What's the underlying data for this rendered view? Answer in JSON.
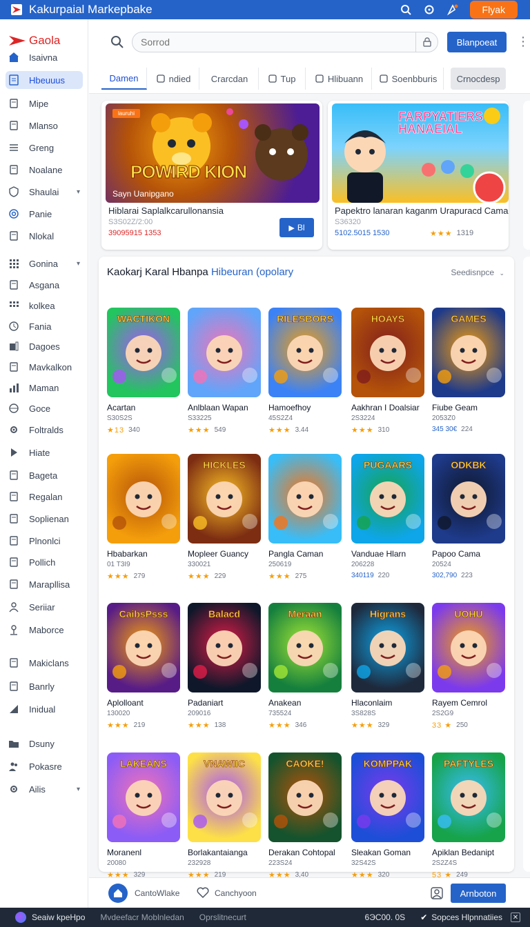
{
  "app": {
    "title": "Kakurpaial Markepbake",
    "fly_button": "Flyak",
    "brand": "Gaola",
    "colors": {
      "primary": "#2563c9",
      "brand_red": "#dc2626",
      "accent_orange": "#f97316",
      "star": "#f59e0b"
    }
  },
  "sidebar": {
    "items": [
      {
        "label": "Isaivna",
        "icon": "home-icon"
      },
      {
        "label": "Hbeuuus",
        "icon": "document-icon",
        "active": true
      },
      {
        "label": "Mipe",
        "icon": "page-icon"
      },
      {
        "label": "Mlanso",
        "icon": "edit-icon"
      },
      {
        "label": "Greng",
        "icon": "list-icon"
      },
      {
        "label": "Noalane",
        "icon": "wrench-icon"
      },
      {
        "label": "Shaulai",
        "icon": "shield-icon",
        "expandable": true
      },
      {
        "label": "Panie",
        "icon": "target-icon"
      },
      {
        "label": "Nlokal",
        "icon": "tray-icon"
      },
      {
        "label": "Gonina",
        "icon": "grid-icon",
        "expandable": true
      },
      {
        "label": "Asgana",
        "icon": "monitor-icon"
      },
      {
        "label": "kolkea",
        "icon": "apps-icon"
      },
      {
        "label": "Fania",
        "icon": "clock-icon"
      },
      {
        "label": "Dagoes",
        "icon": "chart-icon"
      },
      {
        "label": "Mavkalkon",
        "icon": "pen-icon"
      },
      {
        "label": "Maman",
        "icon": "bar-chart-icon"
      },
      {
        "label": "Goce",
        "icon": "globe-icon"
      },
      {
        "label": "Foltralds",
        "icon": "gear-icon"
      },
      {
        "label": "Hiate",
        "icon": "play-icon"
      },
      {
        "label": "Bageta",
        "icon": "note-icon"
      },
      {
        "label": "Regalan",
        "icon": "cloud-icon"
      },
      {
        "label": "Soplienan",
        "icon": "book-icon"
      },
      {
        "label": "Plnonlci",
        "icon": "compass-icon"
      },
      {
        "label": "Pollich",
        "icon": "link-icon"
      },
      {
        "label": "Marapllisa",
        "icon": "tag-icon"
      },
      {
        "label": "Seriiar",
        "icon": "user-icon"
      },
      {
        "label": "Maborce",
        "icon": "person-icon"
      },
      {
        "label": "Makiclans",
        "icon": "network-icon"
      },
      {
        "label": "Banrly",
        "icon": "clipboard-icon"
      },
      {
        "label": "Inidual",
        "icon": "signal-icon"
      },
      {
        "label": "Dsuny",
        "icon": "folder-icon"
      },
      {
        "label": "Pokasre",
        "icon": "people-icon"
      },
      {
        "label": "Ailis",
        "icon": "settings-icon",
        "expandable": true
      }
    ]
  },
  "header": {
    "search_placeholder": "Sorrod",
    "primary_button": "Blanpoeat"
  },
  "tabs": [
    {
      "label": "Damen",
      "icon": "",
      "active": true
    },
    {
      "label": "ndied",
      "icon": "search-icon"
    },
    {
      "label": "Crarcdan",
      "icon": ""
    },
    {
      "label": "Tup",
      "icon": "image-icon"
    },
    {
      "label": "Hlibuann",
      "icon": "window-icon"
    },
    {
      "label": "Soenbburis",
      "icon": "timer-icon"
    },
    {
      "label": "Crnocdesp",
      "icon": ""
    }
  ],
  "featured": [
    {
      "art_text": "POWIRD KION",
      "art_caption": "Sayn Uanipgano",
      "badge": "lauruhi",
      "title": "Hiblarai Saplalkcarullonansia",
      "sub": "S3S02Z/2:00",
      "meta": "39095915 1353",
      "button": "Bl"
    },
    {
      "art_text": "FARPYATIERS HANAEIAL",
      "title": "Papektro lanaran kaganm Urapuracd Caman",
      "sub": "S36320",
      "meta": "5102.5015 1530",
      "rating_stars": 3,
      "rating_count": "1319"
    }
  ],
  "panel": {
    "title_main": "Kaokarj Karal Hbanpa",
    "title_highlight": "Hibeuran (opolary",
    "sort_label": "Seedisnpce",
    "games": [
      {
        "art_text": "WACTIKON",
        "name": "Acartan",
        "sub": "S30S2S",
        "stars_left": "★13",
        "count": "340"
      },
      {
        "art_text": "",
        "name": "Anlblaan Wapan",
        "sub": "S33225",
        "stars_left": "★★★",
        "count": "549"
      },
      {
        "art_text": "RILESBORS",
        "name": "Hamoefhoy",
        "sub": "45S2Z4",
        "stars_left": "★★★",
        "count": "3.44"
      },
      {
        "art_text": "HOAYS",
        "name": "Aakhran I Doalsiar",
        "sub": "2S3224",
        "stars_left": "★★★",
        "count": "310"
      },
      {
        "art_text": "GAMES",
        "name": "Fiube Geam",
        "sub": "2053Z0",
        "stars_left": "345 30€",
        "count": "224",
        "blue": true
      },
      {
        "art_text": "",
        "name": "Hbabarkan",
        "sub": "01 T3I9",
        "stars_left": "★★★",
        "count": "279"
      },
      {
        "art_text": "HICKLES",
        "name": "Mopleer Guancy",
        "sub": "330021",
        "stars_left": "★★★",
        "count": "229"
      },
      {
        "art_text": "",
        "name": "Pangla Caman",
        "sub": "250619",
        "stars_left": "★★★",
        "count": "275"
      },
      {
        "art_text": "PUGAARS",
        "name": "Vanduae Hlarn",
        "sub": "206228",
        "stars_left": "340119",
        "count": "220",
        "blue": true
      },
      {
        "art_text": "ODKBK",
        "name": "Papoo Cama",
        "sub": "20524",
        "stars_left": "302,790",
        "count": "223",
        "blue": true
      },
      {
        "art_text": "CaibsPsss",
        "name": "Aplolloant",
        "sub": "130020",
        "stars_left": "★★★",
        "count": "219"
      },
      {
        "art_text": "Balacd",
        "name": "Padaniart",
        "sub": "209016",
        "stars_left": "★★★",
        "count": "138"
      },
      {
        "art_text": "Meraan",
        "name": "Anakean",
        "sub": "735524",
        "stars_left": "★★★",
        "count": "346"
      },
      {
        "art_text": "Higrans",
        "name": "Hlaconlaim",
        "sub": "3S828S",
        "stars_left": "★★★",
        "count": "329"
      },
      {
        "art_text": "UOHU",
        "name": "Rayem Cemrol",
        "sub": "2S2G9",
        "stars_left": "33 ★",
        "count": "250"
      },
      {
        "art_text": "LAKEANS",
        "name": "Moranenl",
        "sub": "20080",
        "stars_left": "★★★",
        "count": "329"
      },
      {
        "art_text": "VNAWIIC",
        "name": "Borlakantaianga",
        "sub": "232928",
        "stars_left": "★★★",
        "count": "219"
      },
      {
        "art_text": "CAOKE!",
        "name": "Derakan Cohtopal",
        "sub": "223S24",
        "stars_left": "★★★",
        "count": "3,40"
      },
      {
        "art_text": "KOMPPAK",
        "name": "Sleakan Goman",
        "sub": "32S42S",
        "stars_left": "★★★",
        "count": "320"
      },
      {
        "art_text": "PAFTYLES",
        "name": "Apiklan Bedanipt",
        "sub": "2S2Z4S",
        "stars_left": "53 ★",
        "count": "249"
      }
    ]
  },
  "bottombar": {
    "home_label": "CantoWlake",
    "heart_label": "Canchyoon",
    "action_button": "Arnboton"
  },
  "statusbar": {
    "left": "Seaiw kpeHpo",
    "item2": "Mvdeefacr Moblnledan",
    "item3": "Oprslitnecurt",
    "right1": "6ЭC00. 0S",
    "right2": "Sopces Hlpnnatiies"
  }
}
